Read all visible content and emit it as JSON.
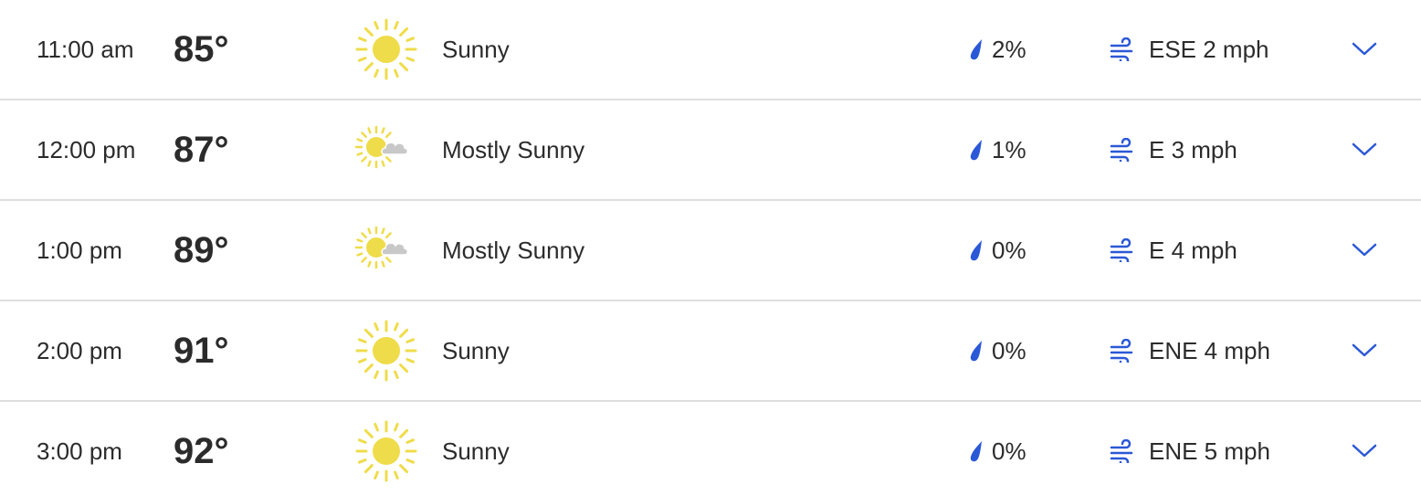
{
  "colors": {
    "accent": "#2b58d6",
    "sun": "#efdc4a",
    "cloud": "#c8c8c8",
    "divider": "#dedede",
    "text": "#2b2b2b"
  },
  "rows": [
    {
      "time": "11:00 am",
      "temp": "85°",
      "icon": "sunny-icon",
      "condition": "Sunny",
      "precip": "2%",
      "wind": "ESE 2 mph"
    },
    {
      "time": "12:00 pm",
      "temp": "87°",
      "icon": "mostly-sunny-icon",
      "condition": "Mostly Sunny",
      "precip": "1%",
      "wind": "E 3 mph"
    },
    {
      "time": "1:00 pm",
      "temp": "89°",
      "icon": "mostly-sunny-icon",
      "condition": "Mostly Sunny",
      "precip": "0%",
      "wind": "E 4 mph"
    },
    {
      "time": "2:00 pm",
      "temp": "91°",
      "icon": "sunny-icon",
      "condition": "Sunny",
      "precip": "0%",
      "wind": "ENE 4 mph"
    },
    {
      "time": "3:00 pm",
      "temp": "92°",
      "icon": "sunny-icon",
      "condition": "Sunny",
      "precip": "0%",
      "wind": "ENE 5 mph"
    }
  ]
}
